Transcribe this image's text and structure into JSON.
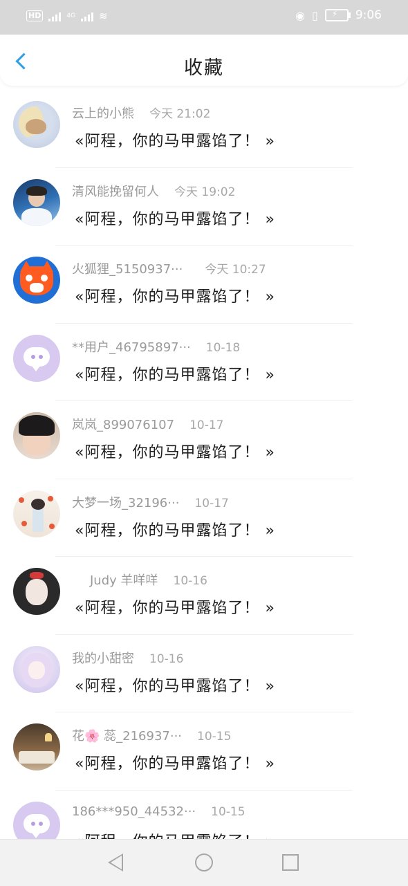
{
  "status_bar": {
    "hd": "HD",
    "network": "4G",
    "time": "9:06"
  },
  "header": {
    "title": "收藏",
    "back_icon": "chevron-left-icon"
  },
  "items": [
    {
      "name": "云上的小熊",
      "time": "今天 21:02",
      "message": "«阿程，你的马甲露馅了！ »",
      "avatar": "bear-moon"
    },
    {
      "name": "清风能挽留何人",
      "time": "今天 19:02",
      "message": "«阿程，你的马甲露馅了！ »",
      "avatar": "boy-photo"
    },
    {
      "name": "火狐狸_5150937···",
      "time": "今天 10:27",
      "message": "«阿程，你的马甲露馅了！ »",
      "avatar": "fox"
    },
    {
      "name": "**用户_46795897···",
      "time": "10-18",
      "message": "«阿程，你的马甲露馅了！ »",
      "avatar": "default-chat"
    },
    {
      "name": "岚岚_899076107",
      "time": "10-17",
      "message": "«阿程，你的马甲露馅了！ »",
      "avatar": "boy-portrait"
    },
    {
      "name": "大梦一场_32196···",
      "time": "10-17",
      "message": "«阿程，你的马甲露馅了！ »",
      "avatar": "girl-art"
    },
    {
      "name": "Judy 羊咩咩",
      "time": "10-16",
      "message": "«阿程，你的马甲露馅了！ »",
      "avatar": "selfie"
    },
    {
      "name": "我的小甜密",
      "time": "10-16",
      "message": "«阿程，你的马甲露馅了！ »",
      "avatar": "anime-girl"
    },
    {
      "name": "花🌸 蕊_216937···",
      "time": "10-15",
      "message": "«阿程，你的马甲露馅了！ »",
      "avatar": "room"
    },
    {
      "name": "186***950_44532···",
      "time": "10-15",
      "message": "«阿程，你的马甲露馅了！ »",
      "avatar": "default-chat"
    }
  ],
  "nav_bar": {
    "back": "triangle-back-icon",
    "home": "circle-home-icon",
    "recent": "square-recent-icon"
  },
  "colors": {
    "accent": "#2d9ee8",
    "status_bar": "#d8d8d8",
    "default_avatar": "#d7c9ef"
  }
}
